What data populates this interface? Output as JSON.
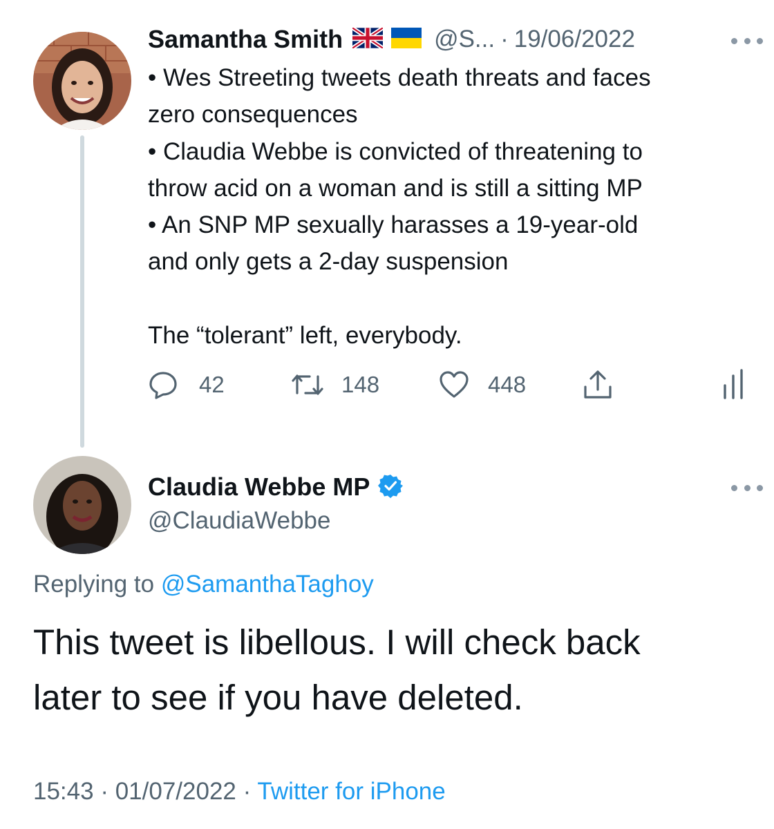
{
  "original_tweet": {
    "author_name": "Samantha Smith",
    "flags": [
      "uk-flag-icon",
      "ukraine-flag-icon"
    ],
    "handle_truncated": "@S...",
    "separator": "·",
    "date": "19/06/2022",
    "lines": [
      "• Wes Streeting tweets death threats and faces",
      "zero consequences",
      "• Claudia Webbe is convicted of threatening to",
      "throw acid on a woman and is still a sitting MP",
      "• An SNP MP sexually harasses a 19-year-old",
      "and only gets a 2-day suspension",
      "",
      "The “tolerant” left, everybody."
    ],
    "actions": {
      "replies": "42",
      "retweets": "148",
      "likes": "448"
    }
  },
  "reply_tweet": {
    "author_name": "Claudia Webbe MP",
    "verified": true,
    "handle": "@ClaudiaWebbe",
    "replying_to_label": "Replying to",
    "replying_to_handle": "@SamanthaTaghoy",
    "lines": [
      "This tweet is libellous. I will check back",
      "later to see if you have deleted."
    ],
    "time": "15:43",
    "separator": "·",
    "date": "01/07/2022",
    "source": "Twitter for iPhone"
  },
  "colors": {
    "accent": "#1d9bf0",
    "muted": "#536471",
    "text": "#0f1419",
    "thread_line": "#cfd9de"
  }
}
